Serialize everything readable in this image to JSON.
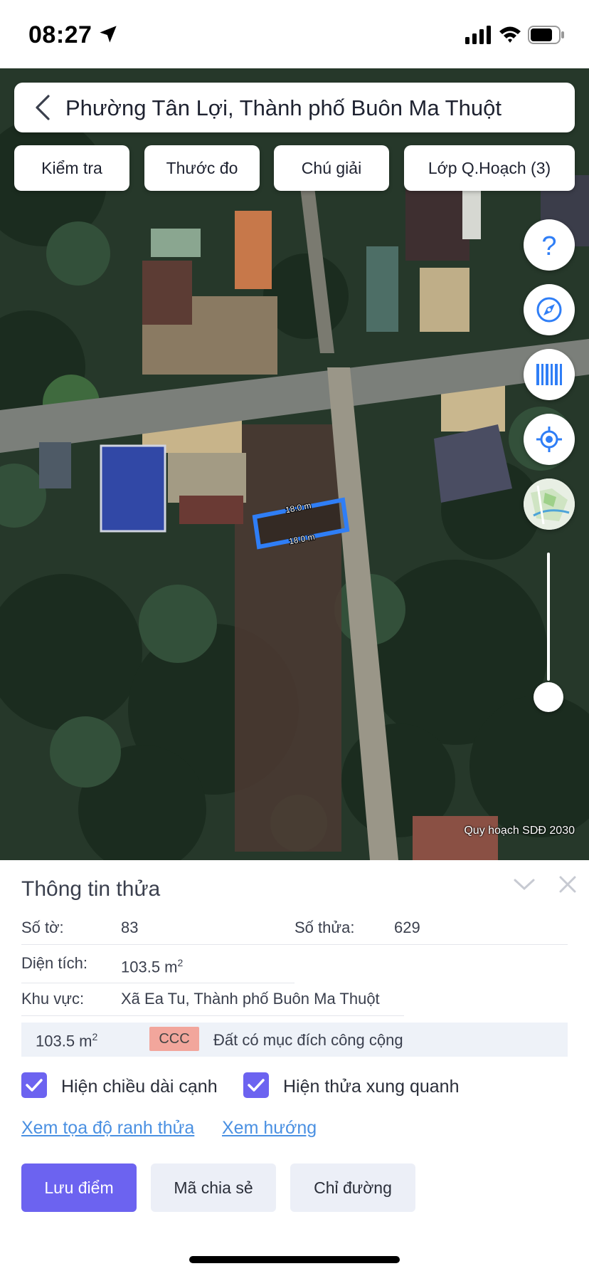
{
  "status_bar": {
    "time": "08:27",
    "icons": [
      "location-arrow-icon",
      "signal-icon",
      "wifi-icon",
      "battery-icon"
    ]
  },
  "map": {
    "search": {
      "title": "Phường Tân Lợi, Thành phố Buôn Ma Thuột",
      "back_icon": "chevron-left-icon"
    },
    "tools": [
      {
        "label": "Kiểm tra"
      },
      {
        "label": "Thước đo"
      },
      {
        "label": "Chú giải"
      },
      {
        "label": "Lớp Q.Hoạch (3)"
      }
    ],
    "side_buttons": [
      "help-icon",
      "compass-icon",
      "barcode-icon",
      "locate-icon",
      "map-layer-thumbnail"
    ],
    "parcel_edges": {
      "top": "18.0 m",
      "bottom": "18.0 m"
    },
    "zoom_level_fraction": 1.0,
    "caption": "Quy hoạch SDĐ 2030",
    "accent": "#2f7ef6"
  },
  "panel": {
    "title": "Thông tin thửa",
    "sheet_label": "Số tờ:",
    "sheet_value": "83",
    "plot_label": "Số thửa:",
    "plot_value": "629",
    "area_label": "Diện tích:",
    "area_value": "103.5 m",
    "area_unit_sup": "2",
    "region_label": "Khu vực:",
    "region_value": "Xã Ea Tu, Thành phố Buôn Ma Thuột",
    "land_use": {
      "area": "103.5 m",
      "area_sup": "2",
      "code": "CCC",
      "code_color": "#f2a69c",
      "description": "Đất có mục đích công cộng"
    },
    "checkboxes": [
      {
        "label": "Hiện chiều dài cạnh",
        "checked": true
      },
      {
        "label": "Hiện thửa xung quanh",
        "checked": true
      }
    ],
    "links": {
      "coords": "Xem tọa độ ranh thửa",
      "direction": "Xem hướng"
    },
    "buttons": {
      "save": "Lưu điểm",
      "share": "Mã chia sẻ",
      "directions": "Chỉ đường"
    },
    "primary_color": "#6c63f0"
  }
}
